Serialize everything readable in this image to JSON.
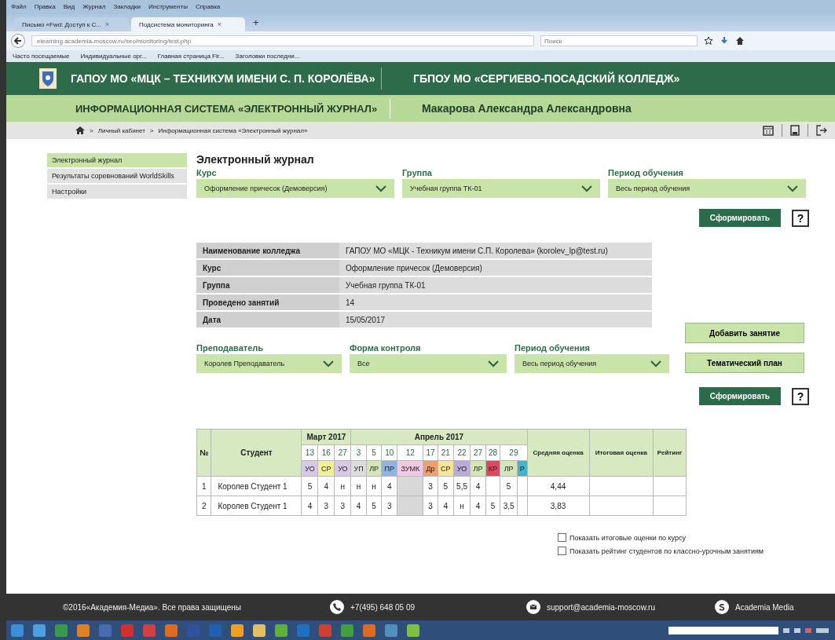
{
  "browser": {
    "menu": [
      "Файл",
      "Правка",
      "Вид",
      "Журнал",
      "Закладки",
      "Инструменты",
      "Справка"
    ],
    "tabs": [
      {
        "label": "Письмо «Fwd: Доступ к С...",
        "close": "×",
        "selected": false
      },
      {
        "label": "Подсистема мониторинга",
        "close": "×",
        "selected": true
      }
    ],
    "new_tab": "+",
    "url": "elearning.academia-moscow.ru/seo/monitoring/test.php",
    "search": {
      "placeholder": "Поиск"
    },
    "bookmarks": [
      "Часто посещаемые",
      "Индивидуальные орг...",
      "Главная страница Fir...",
      "Заголовки последни..."
    ]
  },
  "header": {
    "org_left": "ГАПОУ МО «МЦК – ТЕХНИКУМ ИМЕНИ С. П. КОРОЛЁВА»",
    "org_right": "ГБПОУ МО «СЕРГИЕВО-ПОСАДСКИЙ КОЛЛЕДЖ»",
    "system": "ИНФОРМАЦИОННАЯ СИСТЕМА «ЭЛЕКТРОННЫЙ ЖУРНАЛ»",
    "user": "Макарова Александра Александровна"
  },
  "breadcrumb": {
    "separator": ">",
    "items": [
      "Личный кабинет",
      "Информационная система «Электронный журнал»"
    ]
  },
  "sidebar": {
    "items": [
      {
        "label": "Электронный журнал",
        "selected": true
      },
      {
        "label": "Результаты соревнований WorldSkills",
        "selected": false
      },
      {
        "label": "Настройки",
        "selected": false
      }
    ]
  },
  "page_title": "Электронный журнал",
  "filters": [
    {
      "label": "Курс",
      "value": "Оформление причесок (Демоверсия)"
    },
    {
      "label": "Группа",
      "value": "Учебная группа ТК-01"
    },
    {
      "label": "Период обучения",
      "value": "Весь период обучения"
    }
  ],
  "build_button": "Сформировать",
  "help_button": "?",
  "info": [
    {
      "label": "Наименование колледжа",
      "value": "ГАПОУ МО «МЦК - Техникум имени С.П. Королева» (korolev_lp@test.ru)"
    },
    {
      "label": "Курс",
      "value": "Оформление причесок (Демоверсия)"
    },
    {
      "label": "Группа",
      "value": "Учебная группа ТК-01"
    },
    {
      "label": "Проведено занятий",
      "value": "14"
    },
    {
      "label": "Дата",
      "value": "15/05/2017"
    }
  ],
  "filters2": [
    {
      "label": "Преподаватель",
      "value": "Королев Преподаватель"
    },
    {
      "label": "Форма контроля",
      "value": "Все"
    },
    {
      "label": "Период обучения",
      "value": "Весь период обучения"
    }
  ],
  "side_buttons": [
    "Добавить занятие",
    "Тематический план"
  ],
  "build_button_2": "Сформировать",
  "help_button_2": "?",
  "journal": {
    "columns": {
      "number": "№",
      "student": "Студент",
      "average": "Средняя оценка",
      "final": "Итоговая оценка",
      "rating": "Рейтинг"
    },
    "months": [
      {
        "label": "Март 2017",
        "days": [
          {
            "label": "13",
            "lessons": [
              {
                "type": "УО",
                "color": "#d8c8e8",
                "disabled": false
              }
            ]
          },
          {
            "label": "16",
            "lessons": [
              {
                "type": "СР",
                "color": "#f4ef96",
                "disabled": false
              }
            ]
          },
          {
            "label": "27",
            "lessons": [
              {
                "type": "УО",
                "color": "#d8c8e8",
                "disabled": false
              }
            ]
          }
        ]
      },
      {
        "label": "Апрель 2017",
        "days": [
          {
            "label": "3",
            "lessons": [
              {
                "type": "УП",
                "color": "#dcdcdc",
                "disabled": false
              }
            ]
          },
          {
            "label": "5",
            "lessons": [
              {
                "type": "ЛР",
                "color": "#d4e6b8",
                "disabled": false
              }
            ]
          },
          {
            "label": "10",
            "lessons": [
              {
                "type": "ПР",
                "color": "#8eb4e3",
                "disabled": false
              }
            ]
          },
          {
            "label": "12",
            "lessons": [
              {
                "type": "ЗУМК",
                "color": "#f2c9e3",
                "disabled": true
              }
            ]
          },
          {
            "label": "17",
            "lessons": [
              {
                "type": "Др",
                "color": "#f0a070",
                "disabled": false
              }
            ]
          },
          {
            "label": "21",
            "lessons": [
              {
                "type": "СР",
                "color": "#f9e59a",
                "disabled": false
              }
            ]
          },
          {
            "label": "22",
            "lessons": [
              {
                "type": "УО",
                "color": "#b9acd9",
                "disabled": false
              }
            ]
          },
          {
            "label": "27",
            "lessons": [
              {
                "type": "ЛР",
                "color": "#d4e6b8",
                "disabled": false
              }
            ]
          },
          {
            "label": "28",
            "lessons": [
              {
                "type": "КР",
                "color": "#e2475f",
                "disabled": false
              }
            ]
          },
          {
            "label": "29",
            "lessons": [
              {
                "type": "ЛР",
                "color": "#d4e6b8",
                "disabled": false
              },
              {
                "type": "Р",
                "color": "#41b6cc",
                "disabled": false
              }
            ]
          }
        ]
      }
    ],
    "rows": [
      {
        "number": "1",
        "student": "Королев Студент 1",
        "marks": [
          {
            "kind": "grade",
            "value": "5"
          },
          {
            "kind": "grade",
            "value": "4"
          },
          {
            "kind": "grade",
            "value": "н"
          },
          {
            "kind": "grade",
            "value": "н"
          },
          {
            "kind": "grade",
            "value": "н"
          },
          {
            "kind": "grade",
            "value": "4"
          },
          {
            "kind": "empty"
          },
          {
            "kind": "grade",
            "value": "3"
          },
          {
            "kind": "grade",
            "value": "5"
          },
          {
            "kind": "grade",
            "value": "5,5"
          },
          {
            "kind": "grade",
            "value": "4"
          },
          {
            "kind": "empty"
          },
          {
            "kind": "grade",
            "value": "5"
          },
          {
            "kind": "empty"
          }
        ],
        "average": "4,44"
      },
      {
        "number": "2",
        "student": "Королев Студент 1",
        "marks": [
          {
            "kind": "grade",
            "value": "4"
          },
          {
            "kind": "grade",
            "value": "3"
          },
          {
            "kind": "grade",
            "value": "3"
          },
          {
            "kind": "grade",
            "value": "4"
          },
          {
            "kind": "grade",
            "value": "5"
          },
          {
            "kind": "grade",
            "value": "3"
          },
          {
            "kind": "empty"
          },
          {
            "kind": "grade",
            "value": "3"
          },
          {
            "kind": "grade",
            "value": "4"
          },
          {
            "kind": "grade",
            "value": "н"
          },
          {
            "kind": "grade",
            "value": "4"
          },
          {
            "kind": "grade",
            "value": "5"
          },
          {
            "kind": "grade",
            "value": "3,5"
          },
          {
            "kind": "empty"
          }
        ],
        "average": "3,83"
      }
    ]
  },
  "options": [
    {
      "label": "Показать итоговые оценки по курсу",
      "checked": false
    },
    {
      "label": "Показать рейтинг студентов по классно-урочным занятиям",
      "checked": false
    }
  ],
  "footer": {
    "copyright": "©2016«Академия-Медиа». Все права защищены",
    "phone": "+7(495) 648 05 09",
    "email": "support@academia-moscow.ru",
    "brand": "Academia Media"
  }
}
